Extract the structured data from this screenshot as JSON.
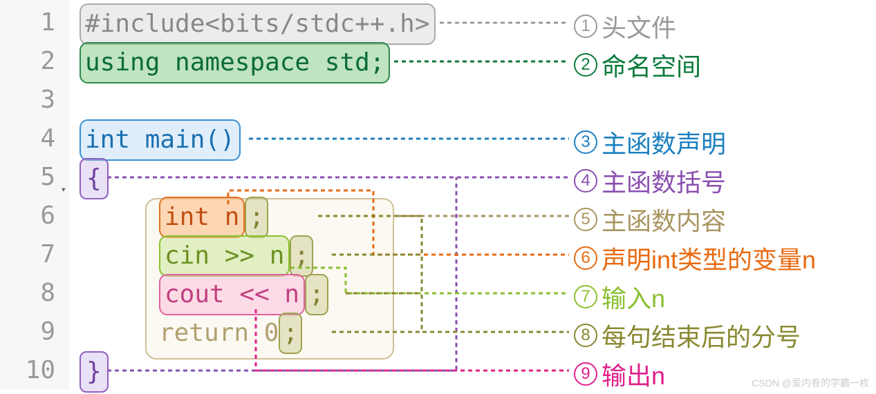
{
  "line_numbers": [
    "1",
    "2",
    "3",
    "4",
    "5",
    "6",
    "7",
    "8",
    "9",
    "10"
  ],
  "code": {
    "l1": "#include<bits/stdc++.h>",
    "l2": "using namespace std;",
    "l4": "int main()",
    "l5": "{",
    "l6_a": "int n",
    "l6_b": ";",
    "l7_a": "cin >> n",
    "l7_b": ";",
    "l8_a": "cout << n",
    "l8_b": ";",
    "l9_a": "return 0",
    "l9_b": ";",
    "l10": "}"
  },
  "annotations": {
    "a1": {
      "num": "1",
      "text": "头文件"
    },
    "a2": {
      "num": "2",
      "text": "命名空间"
    },
    "a3": {
      "num": "3",
      "text": "主函数声明"
    },
    "a4": {
      "num": "4",
      "text": "主函数括号"
    },
    "a5": {
      "num": "5",
      "text": "主函数内容"
    },
    "a6": {
      "num": "6",
      "text": "声明int类型的变量n"
    },
    "a7": {
      "num": "7",
      "text": "输入n"
    },
    "a8": {
      "num": "8",
      "text": "每句结束后的分号"
    },
    "a9": {
      "num": "9",
      "text": "输出n"
    }
  },
  "colors": {
    "gray": "#999",
    "green": "#0a7a3a",
    "blue": "#1a7fc0",
    "purple": "#8a4fb0",
    "tan": "#a89560",
    "orange": "#e86a10",
    "lime": "#8ac030",
    "olive": "#888830",
    "magenta": "#e0208a"
  },
  "watermark": "CSDN @爱内卷的学霸一枚"
}
